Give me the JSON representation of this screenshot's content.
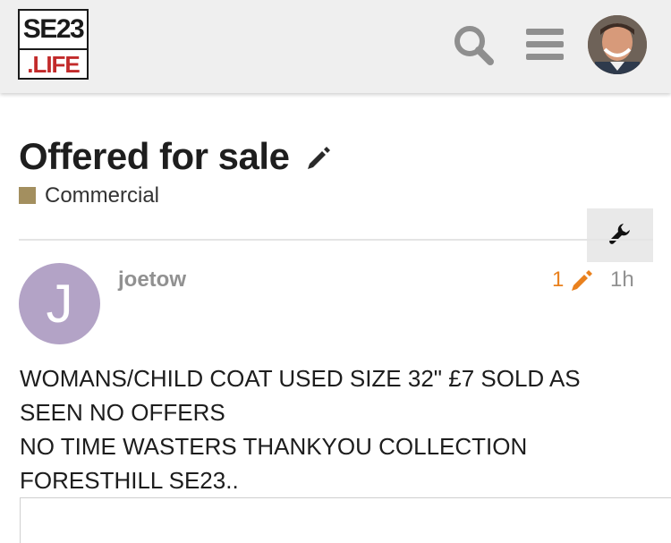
{
  "header": {
    "logo_top": "SE23",
    "logo_bottom": ".LIFE"
  },
  "topic": {
    "title": "Offered for sale",
    "category": "Commercial",
    "category_color": "#a38f5f"
  },
  "post": {
    "avatar_letter": "J",
    "avatar_color": "#b3a3c6",
    "username": "joetow",
    "edit_count": "1",
    "age": "1h",
    "body": [
      "WOMANS/CHILD COAT USED SIZE 32\" £7 SOLD AS",
      "SEEN NO OFFERS",
      "NO TIME WASTERS THANKYOU COLLECTION",
      "FORESTHILL SE23.."
    ]
  },
  "icons": {
    "search": "search-icon",
    "menu": "hamburger-menu-icon",
    "edit": "pencil-icon",
    "admin": "wrench-icon"
  },
  "colors": {
    "header_bg": "#efefef",
    "accent_orange": "#e9811e",
    "logo_red": "#c22a2a"
  }
}
